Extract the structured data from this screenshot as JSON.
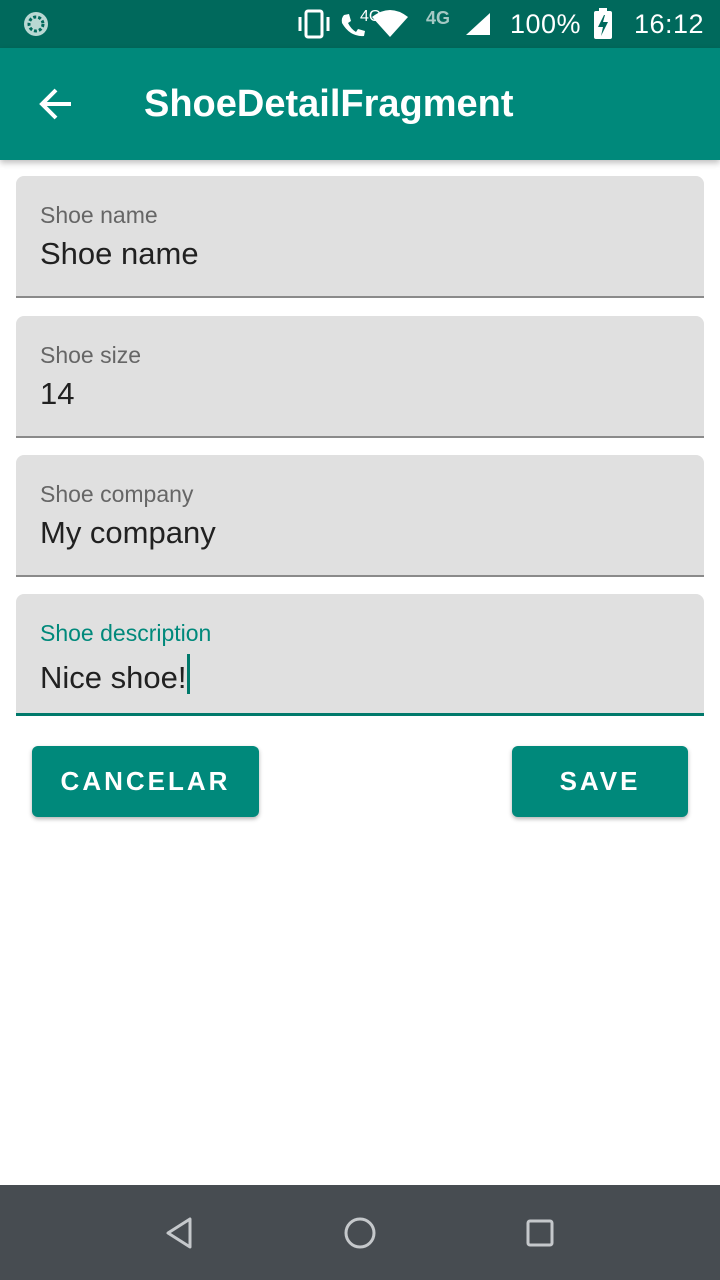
{
  "status_bar": {
    "network_4g_small": "4G",
    "network_4g": "4G",
    "battery": "100%",
    "time": "16:12"
  },
  "app_bar": {
    "title": "ShoeDetailFragment"
  },
  "form": {
    "fields": [
      {
        "label": "Shoe name",
        "value": "Shoe name"
      },
      {
        "label": "Shoe size",
        "value": "14"
      },
      {
        "label": "Shoe company",
        "value": "My company"
      },
      {
        "label": "Shoe description",
        "value": "Nice shoe!"
      }
    ]
  },
  "buttons": {
    "cancel_label": "CANCELAR",
    "save_label": "SAVE"
  },
  "colors": {
    "primary": "#00897b",
    "primary_dark": "#00695c",
    "field_bg": "#e0e0e0",
    "nav_bar": "#474c51"
  }
}
